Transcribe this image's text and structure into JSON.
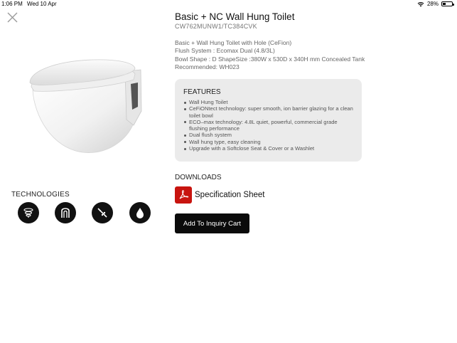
{
  "status_bar": {
    "time": "1:06 PM",
    "date": "Wed 10 Apr",
    "battery": "28%",
    "battery_level": 0.28,
    "icons": [
      "wifi-icon",
      "battery-icon"
    ]
  },
  "close_icon": "close-icon",
  "product": {
    "title": "Basic + NC Wall Hung Toilet",
    "code": "CW762MUNW1/TC384CVK",
    "description_lines": [
      "Basic + Wall Hung Toilet with Hole (CeFion)",
      "Flush System : Ecomax Dual (4.8/3L)",
      "Bowl Shape : D ShapeSize :380W x 530D x 340H mm Concealed Tank",
      "Recommended: WH023"
    ]
  },
  "features": {
    "title": "FEATURES",
    "items": [
      "Wall Hung Toilet",
      "CeFiONtect technology: super smooth, ion barrier glazing for a clean toilet bowl",
      "ECO–max technology: 4.8L quiet, powerful, commercial grade flushing performance",
      "Dual flush system",
      "Wall hung type, easy cleaning",
      "Upgrade with a Softclose Seat & Cover or a Washlet"
    ]
  },
  "technologies": {
    "label": "TECHNOLOGIES",
    "icons": [
      "tornado-flush-icon",
      "siphon-trap-icon",
      "no-clog-icon",
      "water-drop-icon"
    ]
  },
  "downloads": {
    "label": "DOWNLOADS",
    "spec_sheet": "Specification Sheet",
    "spec_icon": "pdf-icon"
  },
  "actions": {
    "add_to_cart": "Add To Inquiry Cart"
  },
  "colors": {
    "accent": "#0b0b0b",
    "pdf_red": "#c8140f",
    "features_bg": "#ebebeb"
  }
}
